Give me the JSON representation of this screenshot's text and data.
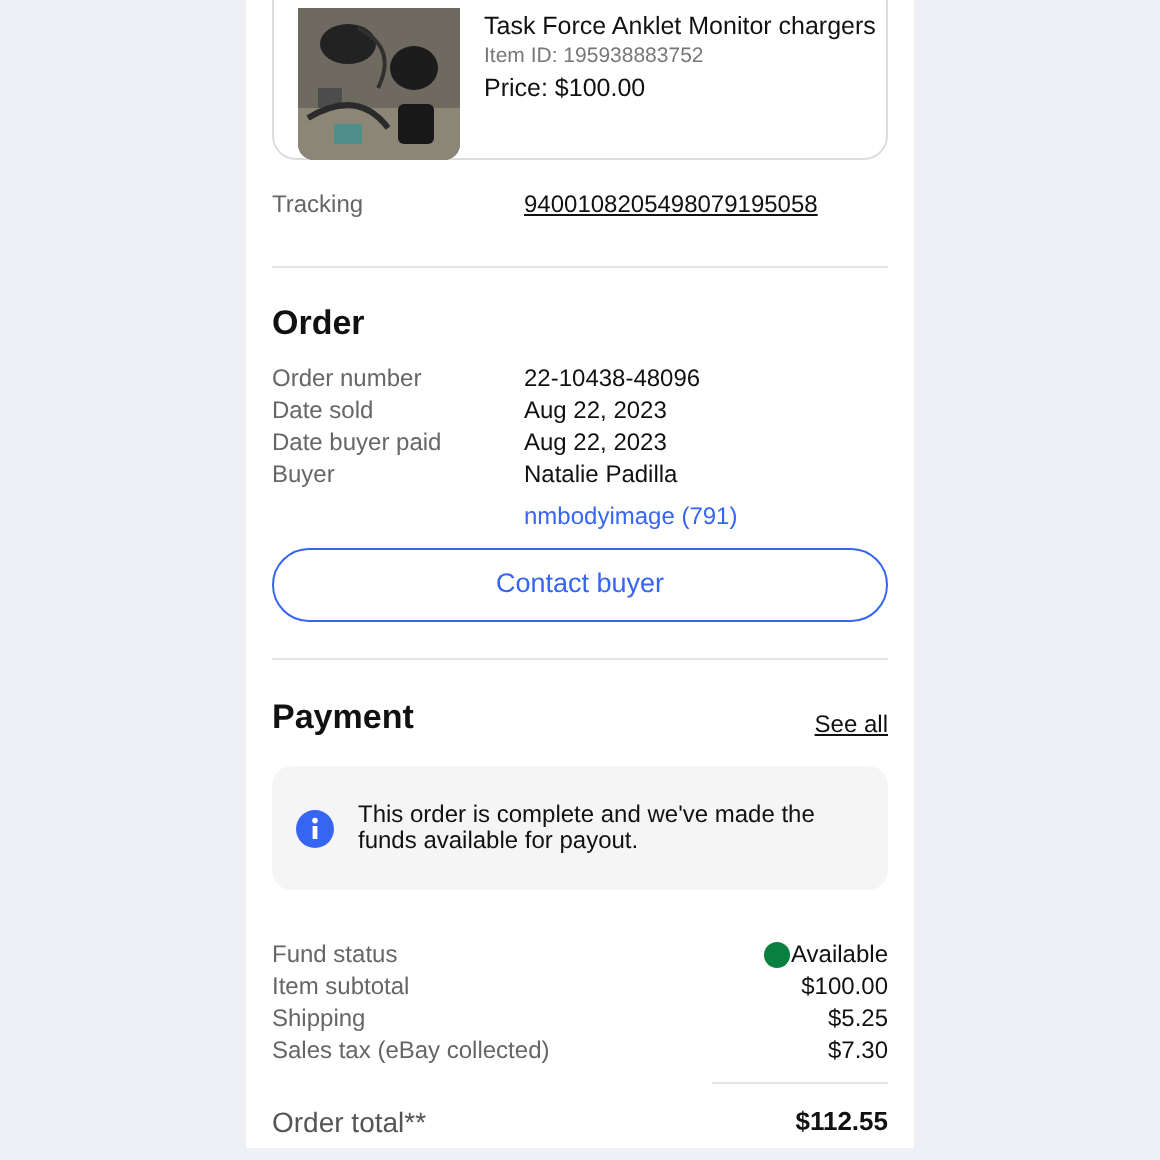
{
  "item": {
    "title": "Task Force Anklet Monitor chargers",
    "item_id": "Item ID: 195938883752",
    "price": "Price: $100.00"
  },
  "tracking": {
    "label": "Tracking",
    "number": "9400108205498079195058"
  },
  "order": {
    "heading": "Order",
    "rows": [
      {
        "label": "Order number",
        "value": "22-10438-48096"
      },
      {
        "label": "Date sold",
        "value": "Aug 22, 2023"
      },
      {
        "label": "Date buyer paid",
        "value": "Aug 22, 2023"
      },
      {
        "label": "Buyer",
        "value": "Natalie Padilla"
      }
    ],
    "buyer_link": "nmbodyimage (791)",
    "contact_button": "Contact buyer"
  },
  "payment": {
    "heading": "Payment",
    "see_all": "See all",
    "notice": "This order is complete and we've made the funds available for payout.",
    "rows": [
      {
        "label": "Fund status",
        "value": "Available",
        "color": "#0a8040"
      },
      {
        "label": "Item subtotal",
        "value": "$100.00"
      },
      {
        "label": "Shipping",
        "value": "$5.25"
      },
      {
        "label": "Sales tax (eBay collected)",
        "value": "$7.30"
      }
    ],
    "total": {
      "label": "Order total**",
      "value": "$112.55"
    }
  }
}
